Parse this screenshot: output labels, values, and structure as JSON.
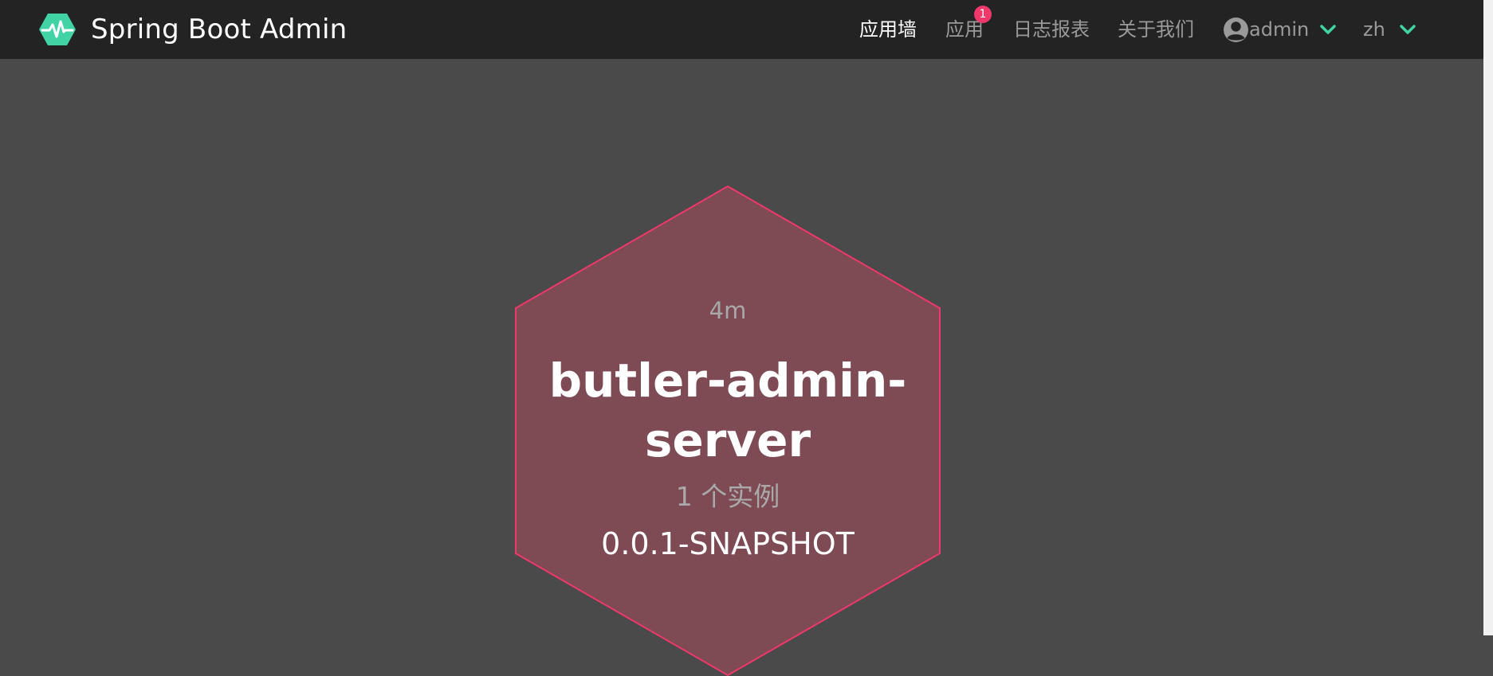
{
  "brand": {
    "title": "Spring Boot Admin",
    "icon": "heartbeat-hexagon-icon",
    "accent_color": "#42d3a5"
  },
  "nav": {
    "items": [
      {
        "label": "应用墙",
        "active": true
      },
      {
        "label": "应用",
        "badge": "1"
      },
      {
        "label": "日志报表"
      },
      {
        "label": "关于我们"
      }
    ],
    "user": {
      "label": "admin",
      "icon": "user-circle-icon"
    },
    "language": {
      "label": "zh"
    }
  },
  "application": {
    "uptime": "4m",
    "name": "butler-admin-server",
    "instances": "1 个实例",
    "version": "0.0.1-SNAPSHOT",
    "status_color": "#f0386b",
    "fill_color": "#7e4a54"
  }
}
